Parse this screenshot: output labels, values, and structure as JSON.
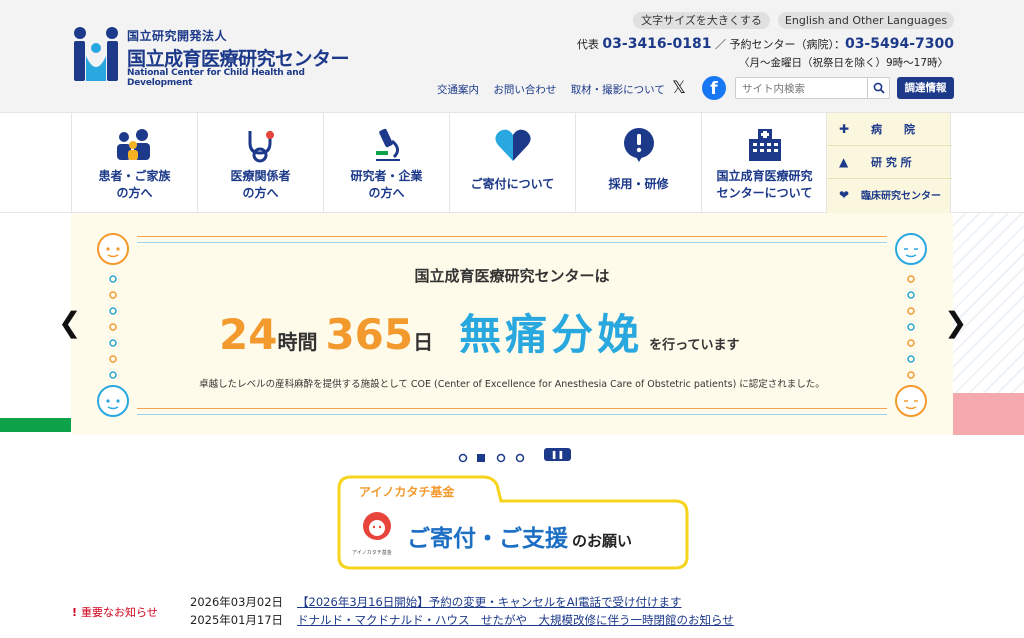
{
  "header": {
    "logo_line1": "国立研究開発法人",
    "logo_line2": "国立成育医療研究センター",
    "logo_line3": "National Center for Child Health and Development",
    "font_size_button": "文字サイズを大きくする",
    "language_button": "English and Other Languages",
    "phone_rep_label": "代表",
    "phone_rep": "03-3416-0181",
    "phone_sep": "／ 予約センター（病院）：",
    "phone_reserve": "03-5494-7300",
    "hours": "〈月〜金曜日（祝祭日を除く）9時〜17時〉",
    "links": [
      "交通案内",
      "お問い合わせ",
      "取材・撮影について"
    ],
    "x_label": "𝕏",
    "facebook_label": "f",
    "search_placeholder": "サイト内検索",
    "procurement_button": "調達情報"
  },
  "nav": {
    "items": [
      {
        "label1": "患者・ご家族",
        "label2": "の方へ"
      },
      {
        "label1": "医療関係者",
        "label2": "の方へ"
      },
      {
        "label1": "研究者・企業",
        "label2": "の方へ"
      },
      {
        "label1": "ご寄付について",
        "label2": ""
      },
      {
        "label1": "採用・研修",
        "label2": ""
      },
      {
        "label1": "国立成育医療研究",
        "label2": "センターについて"
      }
    ],
    "sub": [
      {
        "mark": "✚",
        "label": "病　　院"
      },
      {
        "mark": "▲",
        "label": "研 究 所"
      },
      {
        "mark": "❤",
        "label": "臨床研究センター"
      }
    ]
  },
  "hero": {
    "intro": "国立成育医療研究センターは",
    "num1": "24",
    "unit1": "時間",
    "num2": "365",
    "unit2": "日",
    "main": "無痛分娩",
    "suffix": "を行っています",
    "note": "卓越したレベルの産科麻酔を提供する施設として COE (Center of Excellence for Anesthesia Care of Obstetric patients) に認定されました。",
    "prev_arrow": "❮",
    "next_arrow": "❯",
    "pause_label": "❚❚"
  },
  "banner": {
    "tab": "アイノカタチ基金",
    "logo_caption": "アイノカタチ基金",
    "main": "ご寄付・ご支援",
    "suffix": "のお願い"
  },
  "news": {
    "label": "重要なお知らせ",
    "items": [
      {
        "date": "2026年03月02日",
        "title": "【2026年3月16日開始】予約の変更・キャンセルをAI電話で受け付けます"
      },
      {
        "date": "2025年01月17日",
        "title": "ドナルド・マクドナルド・ハウス　せたがや　大規模改修に伴う一時閉館のお知らせ"
      }
    ]
  },
  "colors": {
    "brand_navy": "#1d3a8a",
    "orange": "#f39a2e",
    "sky": "#29a8e0",
    "alert": "#d0021b"
  }
}
